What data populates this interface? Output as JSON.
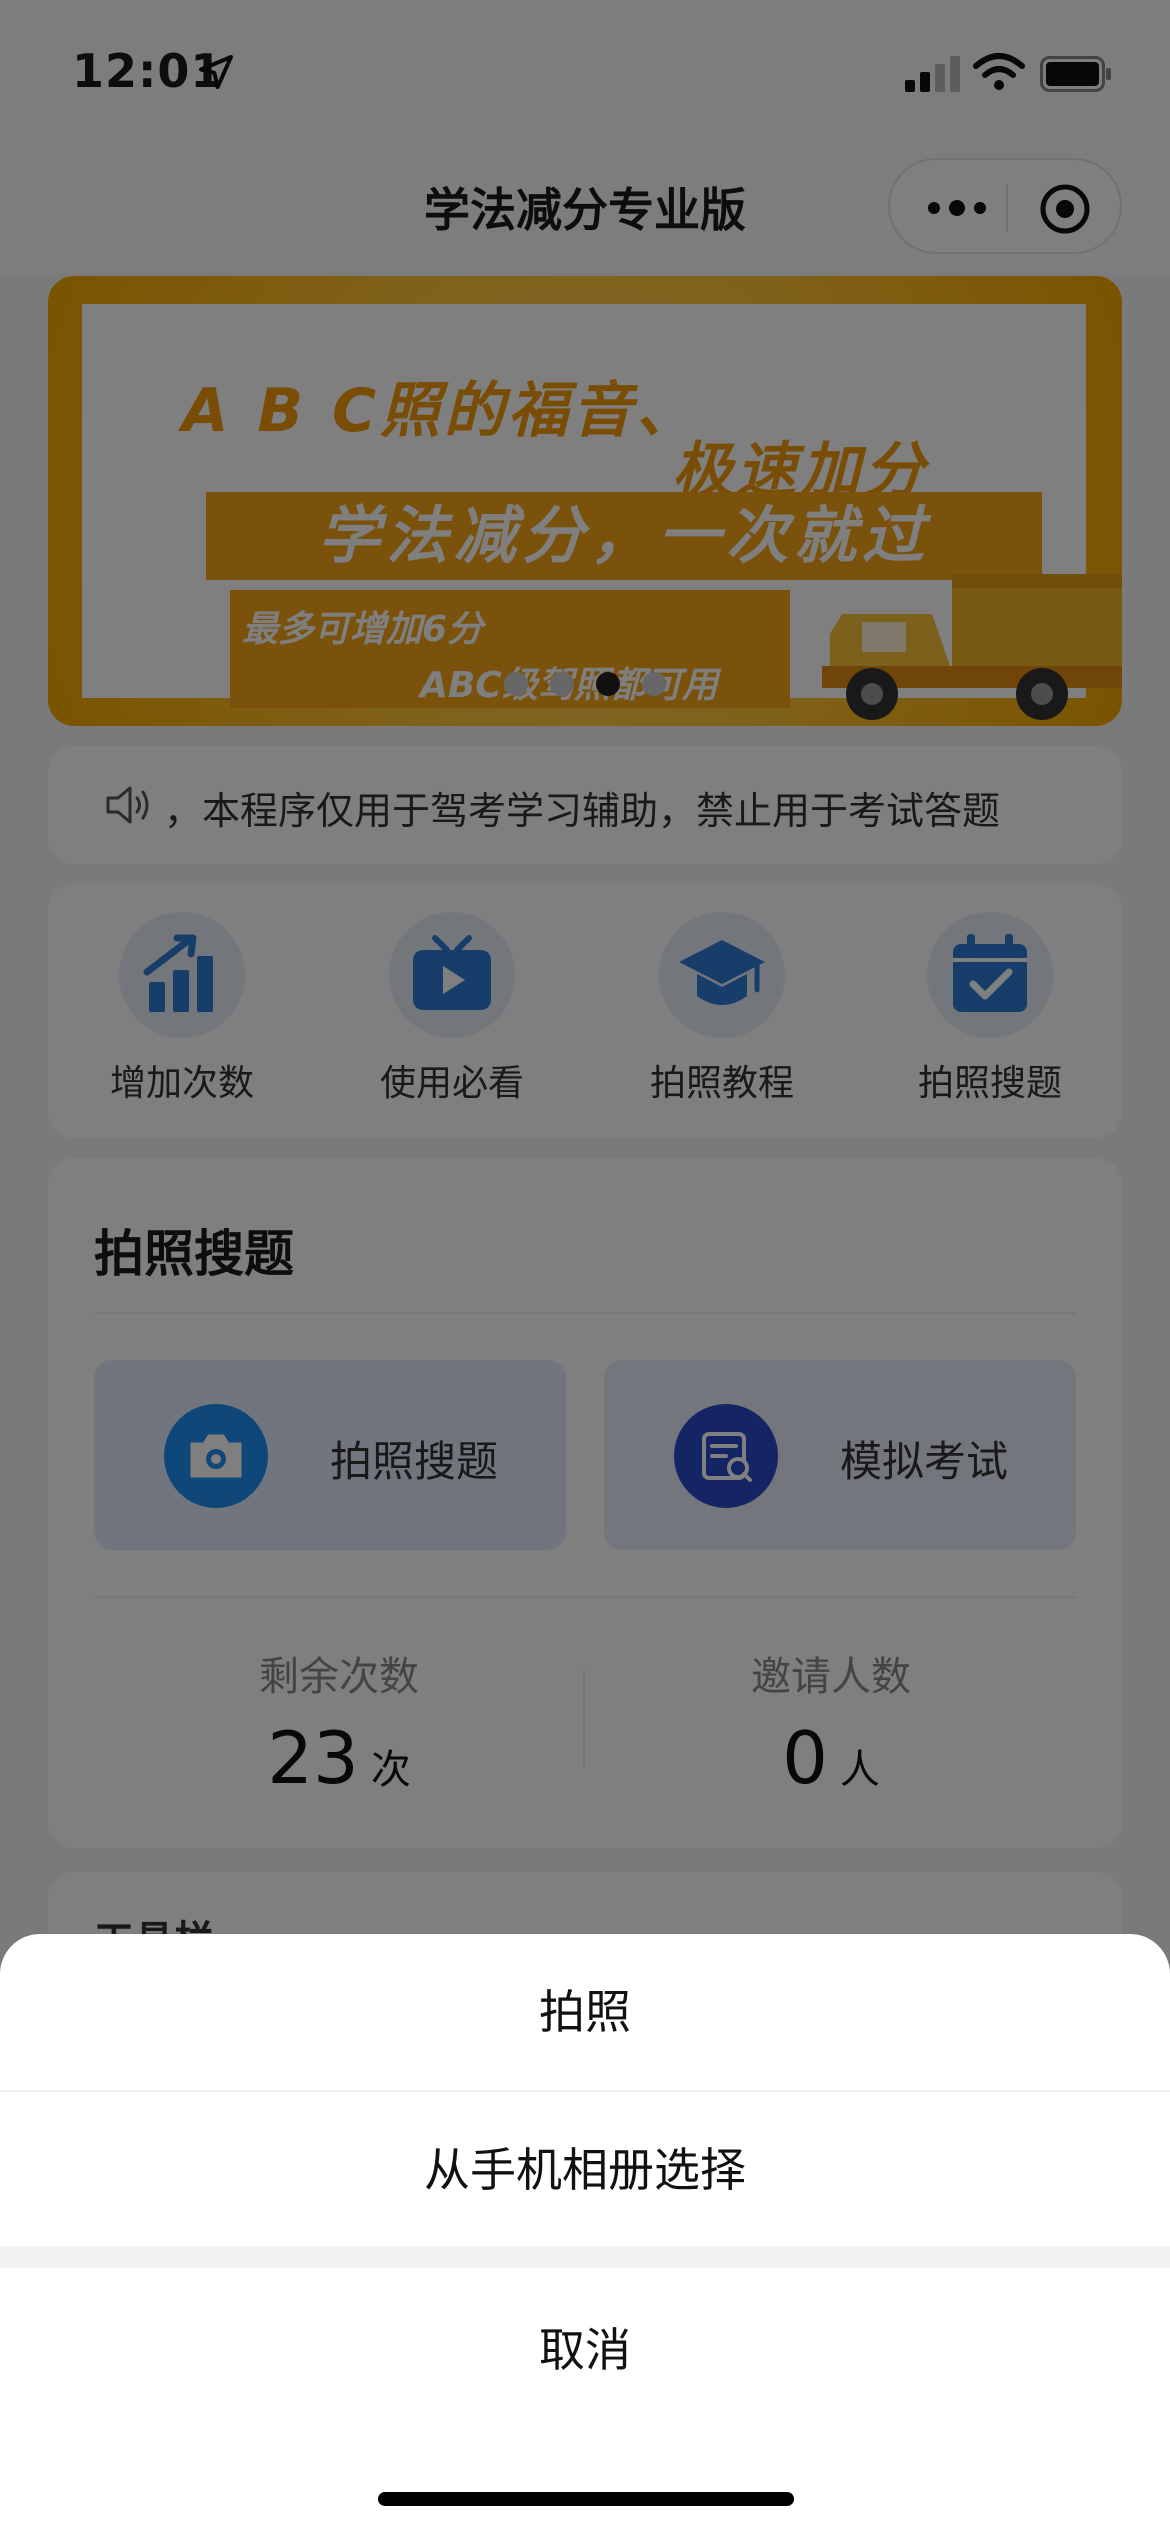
{
  "status_bar": {
    "time": "12:01",
    "icons": [
      "location-arrow-icon",
      "signal-icon",
      "wifi-icon",
      "battery-icon"
    ]
  },
  "nav": {
    "title": "学法减分专业版",
    "capsule_icons": [
      "more-dots-icon",
      "close-target-icon"
    ]
  },
  "banner": {
    "line1": "A B C照的福音、",
    "line2": "极速加分",
    "headline": "学法减分，一次就过",
    "sub1": "最多可增加6分",
    "sub2": "ABC级驾照都可用",
    "dots_count": 4,
    "active_dot": 2,
    "colors": {
      "frame": "#ffc12e",
      "accent": "#f4a516"
    }
  },
  "notice": {
    "icon": "speaker-icon",
    "text": "，本程序仅用于驾考学习辅助，禁止用于考试答题"
  },
  "quick_menu": [
    {
      "label": "增加次数",
      "icon": "bar-chart-up-icon"
    },
    {
      "label": "使用必看",
      "icon": "tv-play-icon"
    },
    {
      "label": "拍照教程",
      "icon": "graduation-cap-icon"
    },
    {
      "label": "拍照搜题",
      "icon": "calendar-check-icon"
    }
  ],
  "photo_card": {
    "title": "拍照搜题",
    "buttons": [
      {
        "label": "拍照搜题",
        "icon": "camera-icon"
      },
      {
        "label": "模拟考试",
        "icon": "exam-paper-icon"
      }
    ],
    "stats": [
      {
        "label": "剩余次数",
        "value": "23",
        "unit": "次"
      },
      {
        "label": "邀请人数",
        "value": "0",
        "unit": "人"
      }
    ]
  },
  "tools": {
    "title": "工具栏"
  },
  "action_sheet": {
    "items": [
      "拍照",
      "从手机相册选择"
    ],
    "cancel": "取消"
  }
}
